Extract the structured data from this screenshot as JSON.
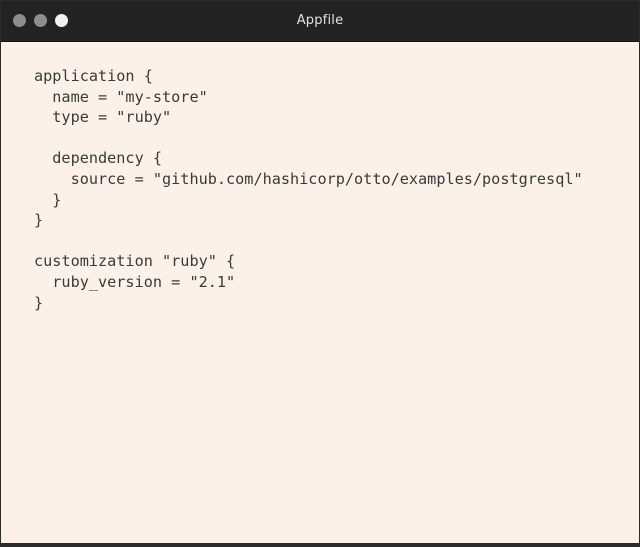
{
  "window": {
    "title": "Appfile",
    "traffic_lights": [
      "close",
      "minimize",
      "maximize"
    ],
    "traffic_light_colors": [
      "#8e8e8e",
      "#8e8e8e",
      "#f2f2f2"
    ]
  },
  "editor": {
    "lines": [
      "application {",
      "  name = \"my-store\"",
      "  type = \"ruby\"",
      "",
      "  dependency {",
      "    source = \"github.com/hashicorp/otto/examples/postgresql\"",
      "  }",
      "}",
      "",
      "customization \"ruby\" {",
      "  ruby_version = \"2.1\"",
      "}"
    ],
    "text_color": "#3a3a3a",
    "background_color": "#fbf1e9"
  }
}
